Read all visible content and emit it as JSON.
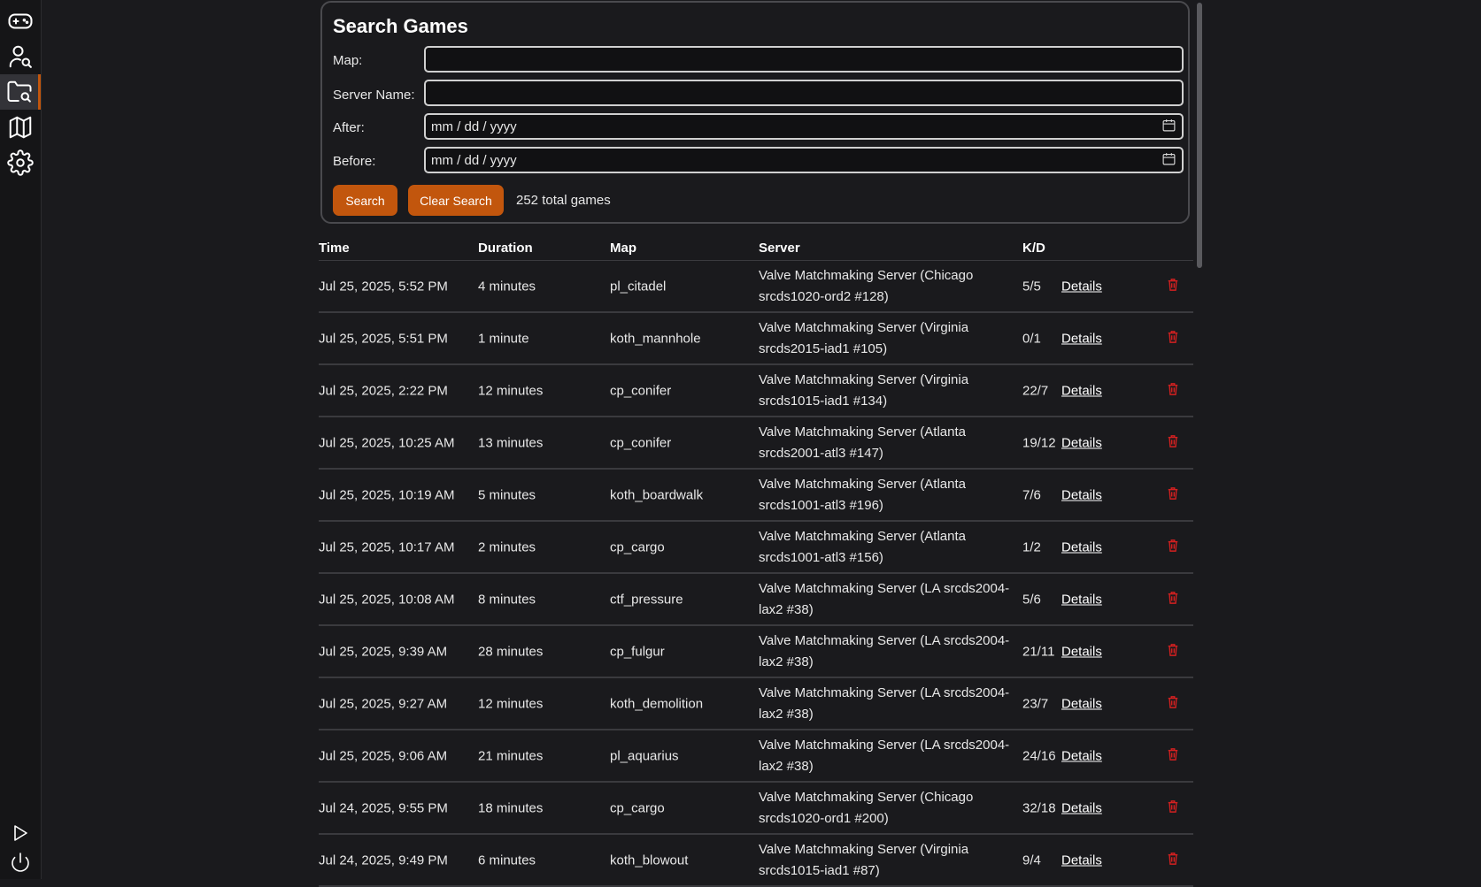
{
  "sidebar": {
    "items": [
      {
        "icon": "gamepad-icon"
      },
      {
        "icon": "user-search-icon"
      },
      {
        "icon": "folder-search-icon",
        "active": true
      },
      {
        "icon": "map-icon"
      },
      {
        "icon": "gear-icon"
      }
    ],
    "bottom": [
      {
        "icon": "play-icon"
      },
      {
        "icon": "power-icon"
      }
    ]
  },
  "search": {
    "title": "Search Games",
    "map_label": "Map:",
    "server_label": "Server Name:",
    "after_label": "After:",
    "before_label": "Before:",
    "date_placeholder": "mm / dd / yyyy",
    "search_button": "Search",
    "clear_button": "Clear Search",
    "total": "252 total games"
  },
  "table": {
    "headers": {
      "time": "Time",
      "duration": "Duration",
      "map": "Map",
      "server": "Server",
      "kd": "K/D"
    },
    "details_label": "Details",
    "rows": [
      {
        "time": "Jul 25, 2025, 5:52 PM",
        "duration": "4 minutes",
        "map": "pl_citadel",
        "server": "Valve Matchmaking Server (Chicago srcds1020-ord2 #128)",
        "kd": "5/5"
      },
      {
        "time": "Jul 25, 2025, 5:51 PM",
        "duration": "1 minute",
        "map": "koth_mannhole",
        "server": "Valve Matchmaking Server (Virginia srcds2015-iad1 #105)",
        "kd": "0/1"
      },
      {
        "time": "Jul 25, 2025, 2:22 PM",
        "duration": "12 minutes",
        "map": "cp_conifer",
        "server": "Valve Matchmaking Server (Virginia srcds1015-iad1 #134)",
        "kd": "22/7"
      },
      {
        "time": "Jul 25, 2025, 10:25 AM",
        "duration": "13 minutes",
        "map": "cp_conifer",
        "server": "Valve Matchmaking Server (Atlanta srcds2001-atl3 #147)",
        "kd": "19/12"
      },
      {
        "time": "Jul 25, 2025, 10:19 AM",
        "duration": "5 minutes",
        "map": "koth_boardwalk",
        "server": "Valve Matchmaking Server (Atlanta srcds1001-atl3 #196)",
        "kd": "7/6"
      },
      {
        "time": "Jul 25, 2025, 10:17 AM",
        "duration": "2 minutes",
        "map": "cp_cargo",
        "server": "Valve Matchmaking Server (Atlanta srcds1001-atl3 #156)",
        "kd": "1/2"
      },
      {
        "time": "Jul 25, 2025, 10:08 AM",
        "duration": "8 minutes",
        "map": "ctf_pressure",
        "server": "Valve Matchmaking Server (LA srcds2004-lax2 #38)",
        "kd": "5/6"
      },
      {
        "time": "Jul 25, 2025, 9:39 AM",
        "duration": "28 minutes",
        "map": "cp_fulgur",
        "server": "Valve Matchmaking Server (LA srcds2004-lax2 #38)",
        "kd": "21/11"
      },
      {
        "time": "Jul 25, 2025, 9:27 AM",
        "duration": "12 minutes",
        "map": "koth_demolition",
        "server": "Valve Matchmaking Server (LA srcds2004-lax2 #38)",
        "kd": "23/7"
      },
      {
        "time": "Jul 25, 2025, 9:06 AM",
        "duration": "21 minutes",
        "map": "pl_aquarius",
        "server": "Valve Matchmaking Server (LA srcds2004-lax2 #38)",
        "kd": "24/16"
      },
      {
        "time": "Jul 24, 2025, 9:55 PM",
        "duration": "18 minutes",
        "map": "cp_cargo",
        "server": "Valve Matchmaking Server (Chicago srcds1020-ord1 #200)",
        "kd": "32/18"
      },
      {
        "time": "Jul 24, 2025, 9:49 PM",
        "duration": "6 minutes",
        "map": "koth_blowout",
        "server": "Valve Matchmaking Server (Virginia srcds1015-iad1 #87)",
        "kd": "9/4"
      }
    ]
  }
}
